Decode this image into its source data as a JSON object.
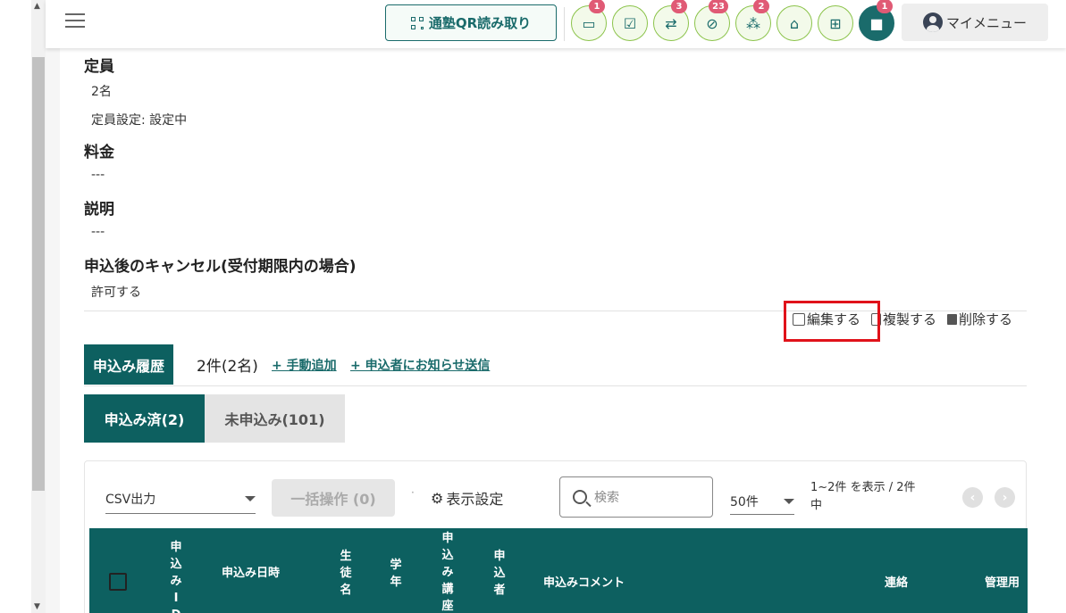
{
  "header": {
    "qr_button": "通塾QR読み取り",
    "icons": [
      {
        "name": "chat-icon",
        "badge": "1"
      },
      {
        "name": "checklist-icon",
        "badge": ""
      },
      {
        "name": "transfer-icon",
        "badge": "3"
      },
      {
        "name": "no-location-icon",
        "badge": "23"
      },
      {
        "name": "group-icon",
        "badge": "2"
      },
      {
        "name": "school-icon",
        "badge": ""
      },
      {
        "name": "gift-icon",
        "badge": ""
      },
      {
        "name": "message-icon",
        "badge": "1"
      }
    ],
    "mymenu_label": "マイメニュー"
  },
  "details": [
    {
      "label": "定員",
      "values": [
        "2名",
        "定員設定: 設定中"
      ]
    },
    {
      "label": "料金",
      "values": [
        "---"
      ]
    },
    {
      "label": "説明",
      "values": [
        "---"
      ]
    },
    {
      "label": "申込後のキャンセル(受付期限内の場合)",
      "values": [
        "許可する"
      ]
    }
  ],
  "actions": {
    "edit": "編集する",
    "copy": "複製する",
    "delete": "削除する"
  },
  "history": {
    "tab_label": "申込み履歴",
    "count": "2件(2名)",
    "manual_add": "+ 手動追加",
    "notify": "+ 申込者にお知らせ送信"
  },
  "segments": {
    "applied": "申込み済(2)",
    "not_applied": "未申込み(101)"
  },
  "toolbar": {
    "csv": "CSV出力",
    "bulk": "一括操作 (0)",
    "display": "表示設定",
    "search_placeholder": "検索",
    "per_page": "50件",
    "range": "1~2件 を表示 / 2件中"
  },
  "table": {
    "headers": [
      "申込みID",
      "申込み日時",
      "生徒名",
      "学年",
      "申込み講座",
      "申込者",
      "申込みコメント",
      "連絡",
      "管理用"
    ]
  }
}
